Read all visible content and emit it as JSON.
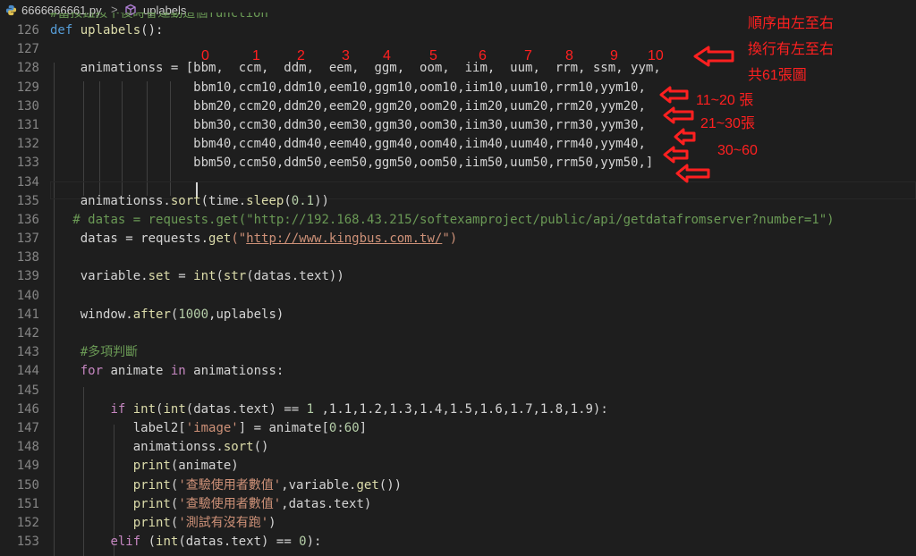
{
  "breadcrumb": {
    "file": "6666666661.py",
    "separator": ">",
    "symbol": "uplabels"
  },
  "ghost_comment": "#當按鈕按下後時會達動這個function",
  "line_numbers": [
    "126",
    "127",
    "128",
    "129",
    "130",
    "131",
    "132",
    "133",
    "134",
    "135",
    "136",
    "137",
    "138",
    "139",
    "140",
    "141",
    "142",
    "143",
    "144",
    "145",
    "146",
    "147",
    "148",
    "149",
    "150",
    "151",
    "152",
    "153"
  ],
  "code": {
    "l126_def": "def",
    "l126_name": "uplabels",
    "l126_rest": "():",
    "l128": "animationss = [bbm,  ccm,  ddm,  eem,  ggm,  oom,  iim,  uum,  rrm, ssm, yym,",
    "l129": "bbm10,ccm10,ddm10,eem10,ggm10,oom10,iim10,uum10,rrm10,yym10,",
    "l130": "bbm20,ccm20,ddm20,eem20,ggm20,oom20,iim20,uum20,rrm20,yym20,",
    "l131": "bbm30,ccm30,ddm30,eem30,ggm30,oom30,iim30,uum30,rrm30,yym30,",
    "l132": "bbm40,ccm40,ddm40,eem40,ggm40,oom40,iim40,uum40,rrm40,yym40,",
    "l133": "bbm50,ccm50,ddm50,eem50,ggm50,oom50,iim50,uum50,rrm50,yym50,]",
    "l135_a": "animationss.",
    "l135_fn": "sort",
    "l135_b": "(time.",
    "l135_fn2": "sleep",
    "l135_c": "(",
    "l135_num": "0.1",
    "l135_d": "))",
    "l136_cm": "# datas = requests.get(\"http://192.168.43.215/softexamproject/public/api/getdatafromserver?number=1\")",
    "l137_a": "datas = requests.",
    "l137_fn": "get",
    "l137_b": "(\"",
    "l137_url": "http://www.kingbus.com.tw/",
    "l137_c": "\")",
    "l139_a": "variable.",
    "l139_fn": "set",
    "l139_b": " = ",
    "l139_int": "int",
    "l139_c": "(",
    "l139_str": "str",
    "l139_d": "(datas.text))",
    "l141_a": "window.",
    "l141_fn": "after",
    "l141_b": "(",
    "l141_num": "1000",
    "l141_c": ",uplabels)",
    "l143_cm": "#多項判斷",
    "l144_for": "for",
    "l144_a": " animate ",
    "l144_in": "in",
    "l144_b": " animationss:",
    "l146_if": "if",
    "l146_a": " ",
    "l146_int1": "int",
    "l146_b": "(",
    "l146_int2": "int",
    "l146_c": "(datas.text) == ",
    "l146_num": "1",
    "l146_d": " ,1.1,1.2,1.3,1.4,1.5,1.6,1.7,1.8,1.9):",
    "l147_a": "label2[",
    "l147_st": "'image'",
    "l147_b": "] = animate[",
    "l147_n1": "0",
    "l147_c": ":",
    "l147_n2": "60",
    "l147_d": "]",
    "l148_a": "animationss.",
    "l148_fn": "sort",
    "l148_b": "()",
    "l149_fn": "print",
    "l149_a": "(animate)",
    "l150_fn": "print",
    "l150_a": "(",
    "l150_st": "'查驗使用者數值'",
    "l150_b": ",variable.",
    "l150_fn2": "get",
    "l150_c": "())",
    "l151_fn": "print",
    "l151_a": "(",
    "l151_st": "'查驗使用者數值'",
    "l151_b": ",datas.text)",
    "l152_fn": "print",
    "l152_a": "(",
    "l152_st": "'測試有沒有跑'",
    "l152_b": ")",
    "l153_elif": "elif",
    "l153_a": " (",
    "l153_int": "int",
    "l153_b": "(datas.text) == ",
    "l153_num": "0",
    "l153_c": "):"
  },
  "annotations": {
    "index_labels": [
      "0",
      "1",
      "2",
      "3",
      "4",
      "5",
      "6",
      "7",
      "8",
      "9",
      "10"
    ],
    "note1": "順序由左至右",
    "note2": "換行有左至右",
    "note3": "共61張圖",
    "range1": "11~20 張",
    "range2": "21~30張",
    "range3": "30~60"
  },
  "colors": {
    "background": "#1e1e1e",
    "annotation_red": "#ff2020",
    "keyword": "#569cd6",
    "function": "#dcdcaa",
    "string": "#ce9178",
    "number": "#b5cea8",
    "comment": "#6a9955"
  }
}
